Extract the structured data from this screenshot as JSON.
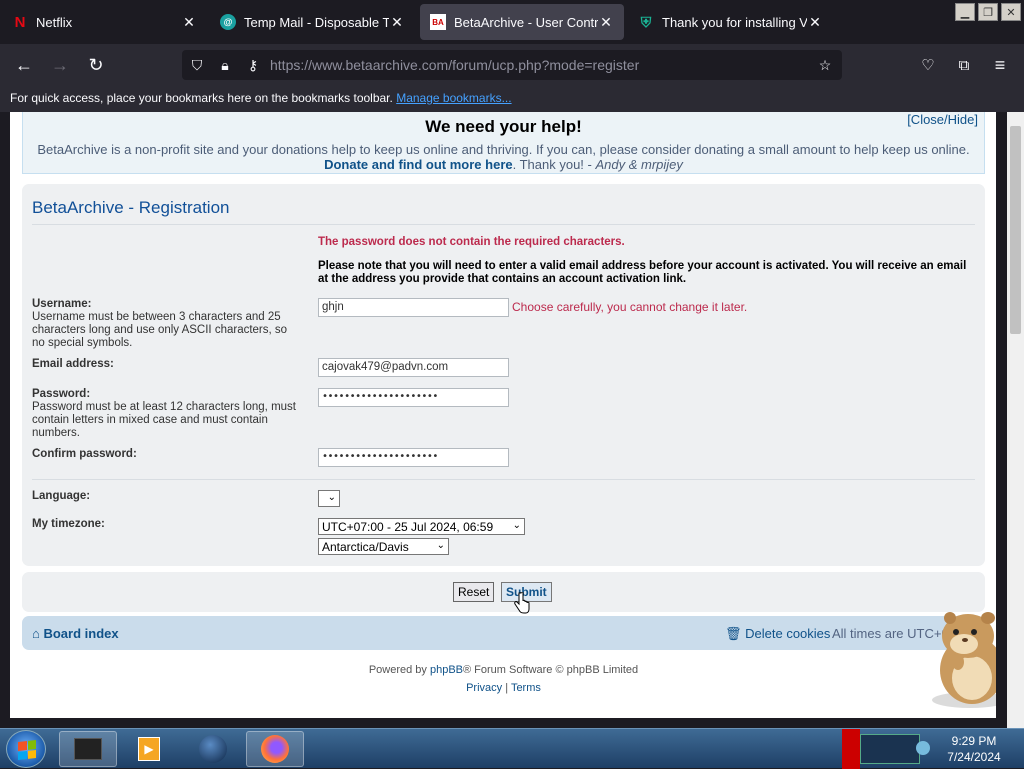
{
  "browser": {
    "tabs": [
      {
        "title": "Netflix",
        "favicon": "netflix-icon",
        "active": false
      },
      {
        "title": "Temp Mail - Disposable Temporary",
        "favicon": "tempmail-icon",
        "active": false
      },
      {
        "title": "BetaArchive - User Control Panel",
        "favicon": "betaarchive-icon",
        "active": true
      },
      {
        "title": "Thank you for installing Veeam",
        "favicon": "shield-icon",
        "active": false
      }
    ],
    "url_domain": "https://www.betaarchive.com",
    "url_path": "/forum/ucp.php?mode=register",
    "bookmarks_text": "For quick access, place your bookmarks here on the bookmarks toolbar.",
    "bookmarks_link": "Manage bookmarks..."
  },
  "donate": {
    "heading": "We need your help!",
    "close_label": "[Close/Hide]",
    "text_part1": "BetaArchive is a non-profit site and your donations help to keep us online and thriving. If you can, please consider donating a small amount to help keep us online.",
    "link": "Donate and find out more here",
    "text_part2": ". Thank you! -",
    "signature": "Andy & mrpijey"
  },
  "form": {
    "title": "BetaArchive - Registration",
    "error": "The password does not contain the required characters.",
    "note": "Please note that you will need to enter a valid email address before your account is activated. You will receive an email at the address you provide that contains an account activation link.",
    "username_label": "Username:",
    "username_desc": "Username must be between 3 characters and 25 characters long and use only ASCII characters, so no special symbols.",
    "username_value": "ghjn",
    "username_hint": "Choose carefully, you cannot change it later.",
    "email_label": "Email address:",
    "email_value": "cajovak479@padvn.com",
    "password_label": "Password:",
    "password_desc": "Password must be at least 12 characters long, must contain letters in mixed case and must contain numbers.",
    "password_value": "•••••••••••••••••••••",
    "confirm_label": "Confirm password:",
    "confirm_value": "•••••••••••••••••••••",
    "language_label": "Language:",
    "timezone_label": "My timezone:",
    "timezone_value": "UTC+07:00 - 25 Jul 2024, 06:59",
    "timezone_region": "Antarctica/Davis",
    "reset_label": "Reset",
    "submit_label": "Submit"
  },
  "footer": {
    "board_index": "Board index",
    "delete_cookies": "Delete cookies",
    "times": "All times are UTC+0",
    "powered_prefix": "Powered by",
    "phpbb": "phpBB",
    "powered_suffix": "® Forum Software © phpBB Limited",
    "privacy": "Privacy",
    "sep": "|",
    "terms": "Terms"
  },
  "taskbar": {
    "time": "9:29 PM",
    "date": "7/24/2024"
  },
  "colors": {
    "accent": "#105289",
    "error": "#bc2a4d",
    "panel": "#eef0f2"
  }
}
